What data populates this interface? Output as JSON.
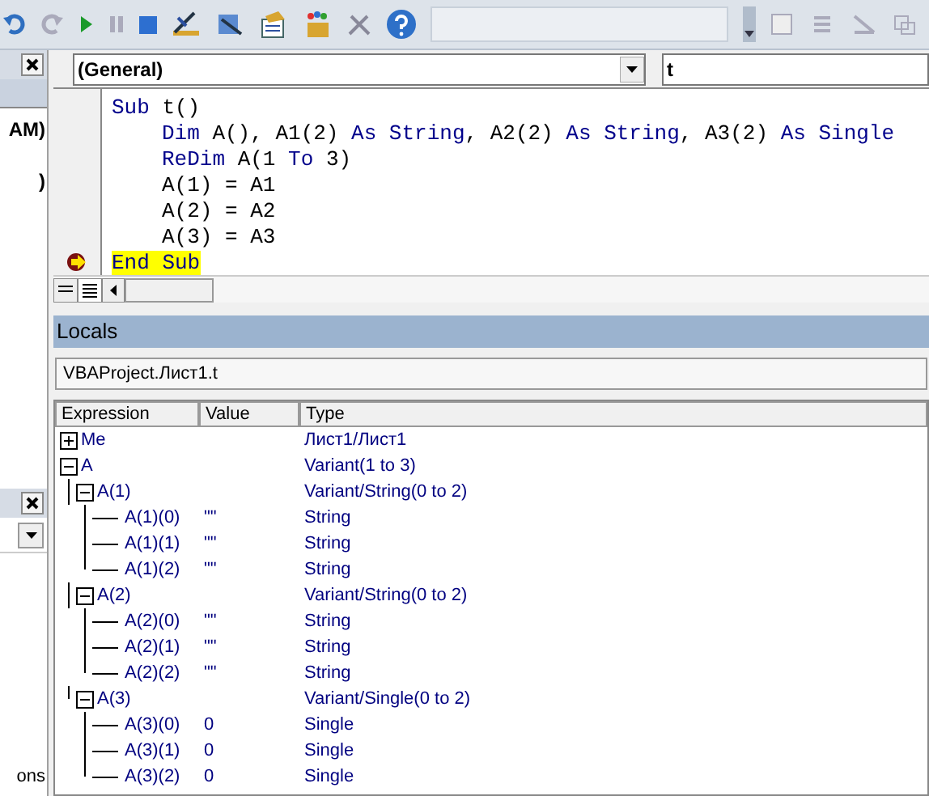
{
  "left_panel": {
    "texts": [
      "AM)",
      ")",
      "ons"
    ]
  },
  "code_window": {
    "object_box": "(General)",
    "procedure_box": "t",
    "lines": [
      {
        "current": false,
        "tokens": [
          {
            "kind": "keyword",
            "text": "Sub"
          },
          {
            "kind": "plain",
            "text": " t()"
          }
        ]
      },
      {
        "current": false,
        "indented": true,
        "tokens": [
          {
            "kind": "keyword",
            "text": "Dim"
          },
          {
            "kind": "plain",
            "text": " A(), A1(2) "
          },
          {
            "kind": "keyword",
            "text": "As String"
          },
          {
            "kind": "plain",
            "text": ", A2(2) "
          },
          {
            "kind": "keyword",
            "text": "As String"
          },
          {
            "kind": "plain",
            "text": ", A3(2) "
          },
          {
            "kind": "keyword",
            "text": "As Single"
          }
        ]
      },
      {
        "current": false,
        "indented": true,
        "tokens": [
          {
            "kind": "keyword",
            "text": "ReDim"
          },
          {
            "kind": "plain",
            "text": " A(1 "
          },
          {
            "kind": "keyword",
            "text": "To"
          },
          {
            "kind": "plain",
            "text": " 3)"
          }
        ]
      },
      {
        "current": false,
        "indented": true,
        "tokens": [
          {
            "kind": "plain",
            "text": "A(1) = A1"
          }
        ]
      },
      {
        "current": false,
        "indented": true,
        "tokens": [
          {
            "kind": "plain",
            "text": "A(2) = A2"
          }
        ]
      },
      {
        "current": false,
        "indented": true,
        "tokens": [
          {
            "kind": "plain",
            "text": "A(3) = A3"
          }
        ]
      },
      {
        "current": true,
        "tokens": [
          {
            "kind": "keyword",
            "text": "End Sub"
          }
        ]
      }
    ]
  },
  "locals": {
    "title": "Locals",
    "context": "VBAProject.Лист1.t",
    "columns": [
      "Expression",
      "Value",
      "Type"
    ],
    "rows": [
      {
        "expression": "Me",
        "type": "Лист1/Лист1",
        "expanded": false,
        "children": []
      },
      {
        "expression": "A",
        "type": "Variant(1 to 3)",
        "expanded": true,
        "children": [
          {
            "expression": "A(1)",
            "type": "Variant/String(0 to 2)",
            "expanded": true,
            "children": [
              {
                "expression": "A(1)(0)",
                "value": "\"\"",
                "type": "String"
              },
              {
                "expression": "A(1)(1)",
                "value": "\"\"",
                "type": "String"
              },
              {
                "expression": "A(1)(2)",
                "value": "\"\"",
                "type": "String"
              }
            ]
          },
          {
            "expression": "A(2)",
            "type": "Variant/String(0 to 2)",
            "expanded": true,
            "children": [
              {
                "expression": "A(2)(0)",
                "value": "\"\"",
                "type": "String"
              },
              {
                "expression": "A(2)(1)",
                "value": "\"\"",
                "type": "String"
              },
              {
                "expression": "A(2)(2)",
                "value": "\"\"",
                "type": "String"
              }
            ]
          },
          {
            "expression": "A(3)",
            "type": "Variant/Single(0 to 2)",
            "expanded": true,
            "children": [
              {
                "expression": "A(3)(0)",
                "value": "0",
                "type": "Single"
              },
              {
                "expression": "A(3)(1)",
                "value": "0",
                "type": "Single"
              },
              {
                "expression": "A(3)(2)",
                "value": "0",
                "type": "Single"
              }
            ]
          }
        ]
      }
    ]
  }
}
